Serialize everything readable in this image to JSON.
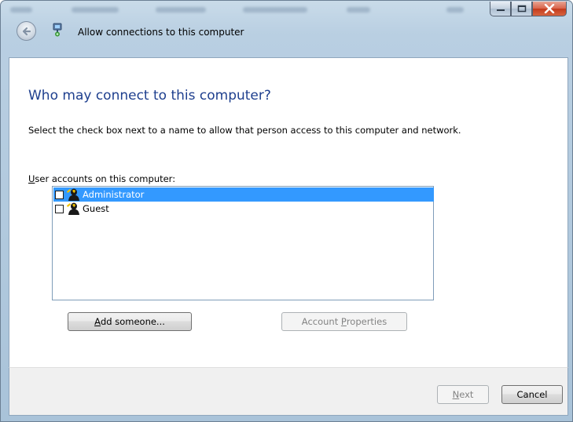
{
  "window": {
    "title": "Allow connections to this computer",
    "caption_buttons": [
      "minimize-icon",
      "maximize-icon",
      "close-icon"
    ]
  },
  "main": {
    "heading": "Who may connect to this computer?",
    "instruction": "Select the check box next to a name to allow that person access to this computer and network.",
    "list_label_mnemonic": "U",
    "list_label_rest": "ser accounts on this computer:",
    "accounts": [
      {
        "name": "Administrator",
        "checked": false,
        "selected": true
      },
      {
        "name": "Guest",
        "checked": false,
        "selected": false
      }
    ]
  },
  "buttons": {
    "add_mnemonic": "A",
    "add_rest": "dd someone...",
    "props_prefix": "Account ",
    "props_mnemonic": "P",
    "props_rest": "roperties",
    "next_mnemonic": "N",
    "next_rest": "ext",
    "cancel": "Cancel"
  },
  "colors": {
    "heading": "#1e3f8e",
    "selection": "#3399ff",
    "close_button": "#c33a1c"
  }
}
